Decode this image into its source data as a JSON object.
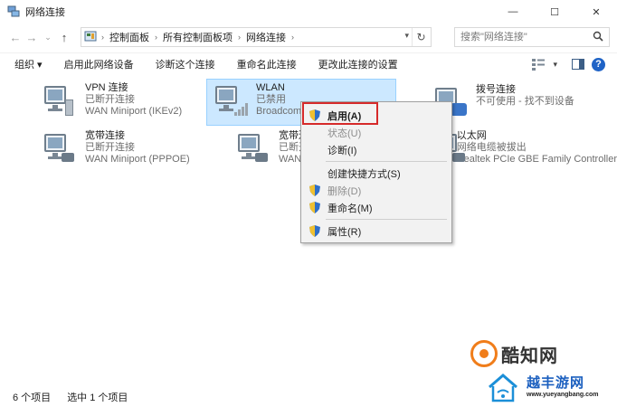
{
  "window": {
    "title": "网络连接",
    "minimize": "—",
    "maximize": "☐",
    "close": "✕"
  },
  "nav": {
    "back": "←",
    "forward": "→",
    "recent": "⌄",
    "up": "↑"
  },
  "breadcrumb": [
    "控制面板",
    "所有控制面板项",
    "网络连接"
  ],
  "search": {
    "placeholder": "搜索\"网络连接\""
  },
  "toolbar": {
    "organize": "组织 ▾",
    "enable_device": "启用此网络设备",
    "diagnose": "诊断这个连接",
    "rename": "重命名此连接",
    "change_settings": "更改此连接的设置",
    "help": "?"
  },
  "connections": [
    {
      "name": "VPN 连接",
      "status": "已断开连接",
      "device": "WAN Miniport (IKEv2)"
    },
    {
      "name": "WLAN",
      "status": "已禁用",
      "device": "Broadcom 802.11n"
    },
    {
      "name": "拨号连接",
      "status": "不可使用 - 找不到设备",
      "device": ""
    },
    {
      "name": "宽带连接",
      "status": "已断开连接",
      "device": "WAN Miniport (PPPOE)"
    },
    {
      "name": "宽带连接 2",
      "status": "已断开连接",
      "device": "WAN Miniport (PPPOE)"
    },
    {
      "name": "以太网",
      "status": "网络电缆被拔出",
      "device": "Realtek PCIe GBE Family Controller"
    }
  ],
  "context_menu": {
    "enable": "启用(A)",
    "status": "状态(U)",
    "diagnose": "诊断(I)",
    "create_shortcut": "创建快捷方式(S)",
    "delete": "删除(D)",
    "rename": "重命名(M)",
    "properties": "属性(R)"
  },
  "statusbar": {
    "item_count": "6 个项目",
    "selected": "选中 1 个项目"
  },
  "watermarks": {
    "site1": "酷知网",
    "site2": "越丰游网",
    "url": "www.yueyangbang.com"
  },
  "colors": {
    "selection_bg": "#cce8ff",
    "highlight_border": "#d62a2a",
    "help_blue": "#1f63c6"
  }
}
